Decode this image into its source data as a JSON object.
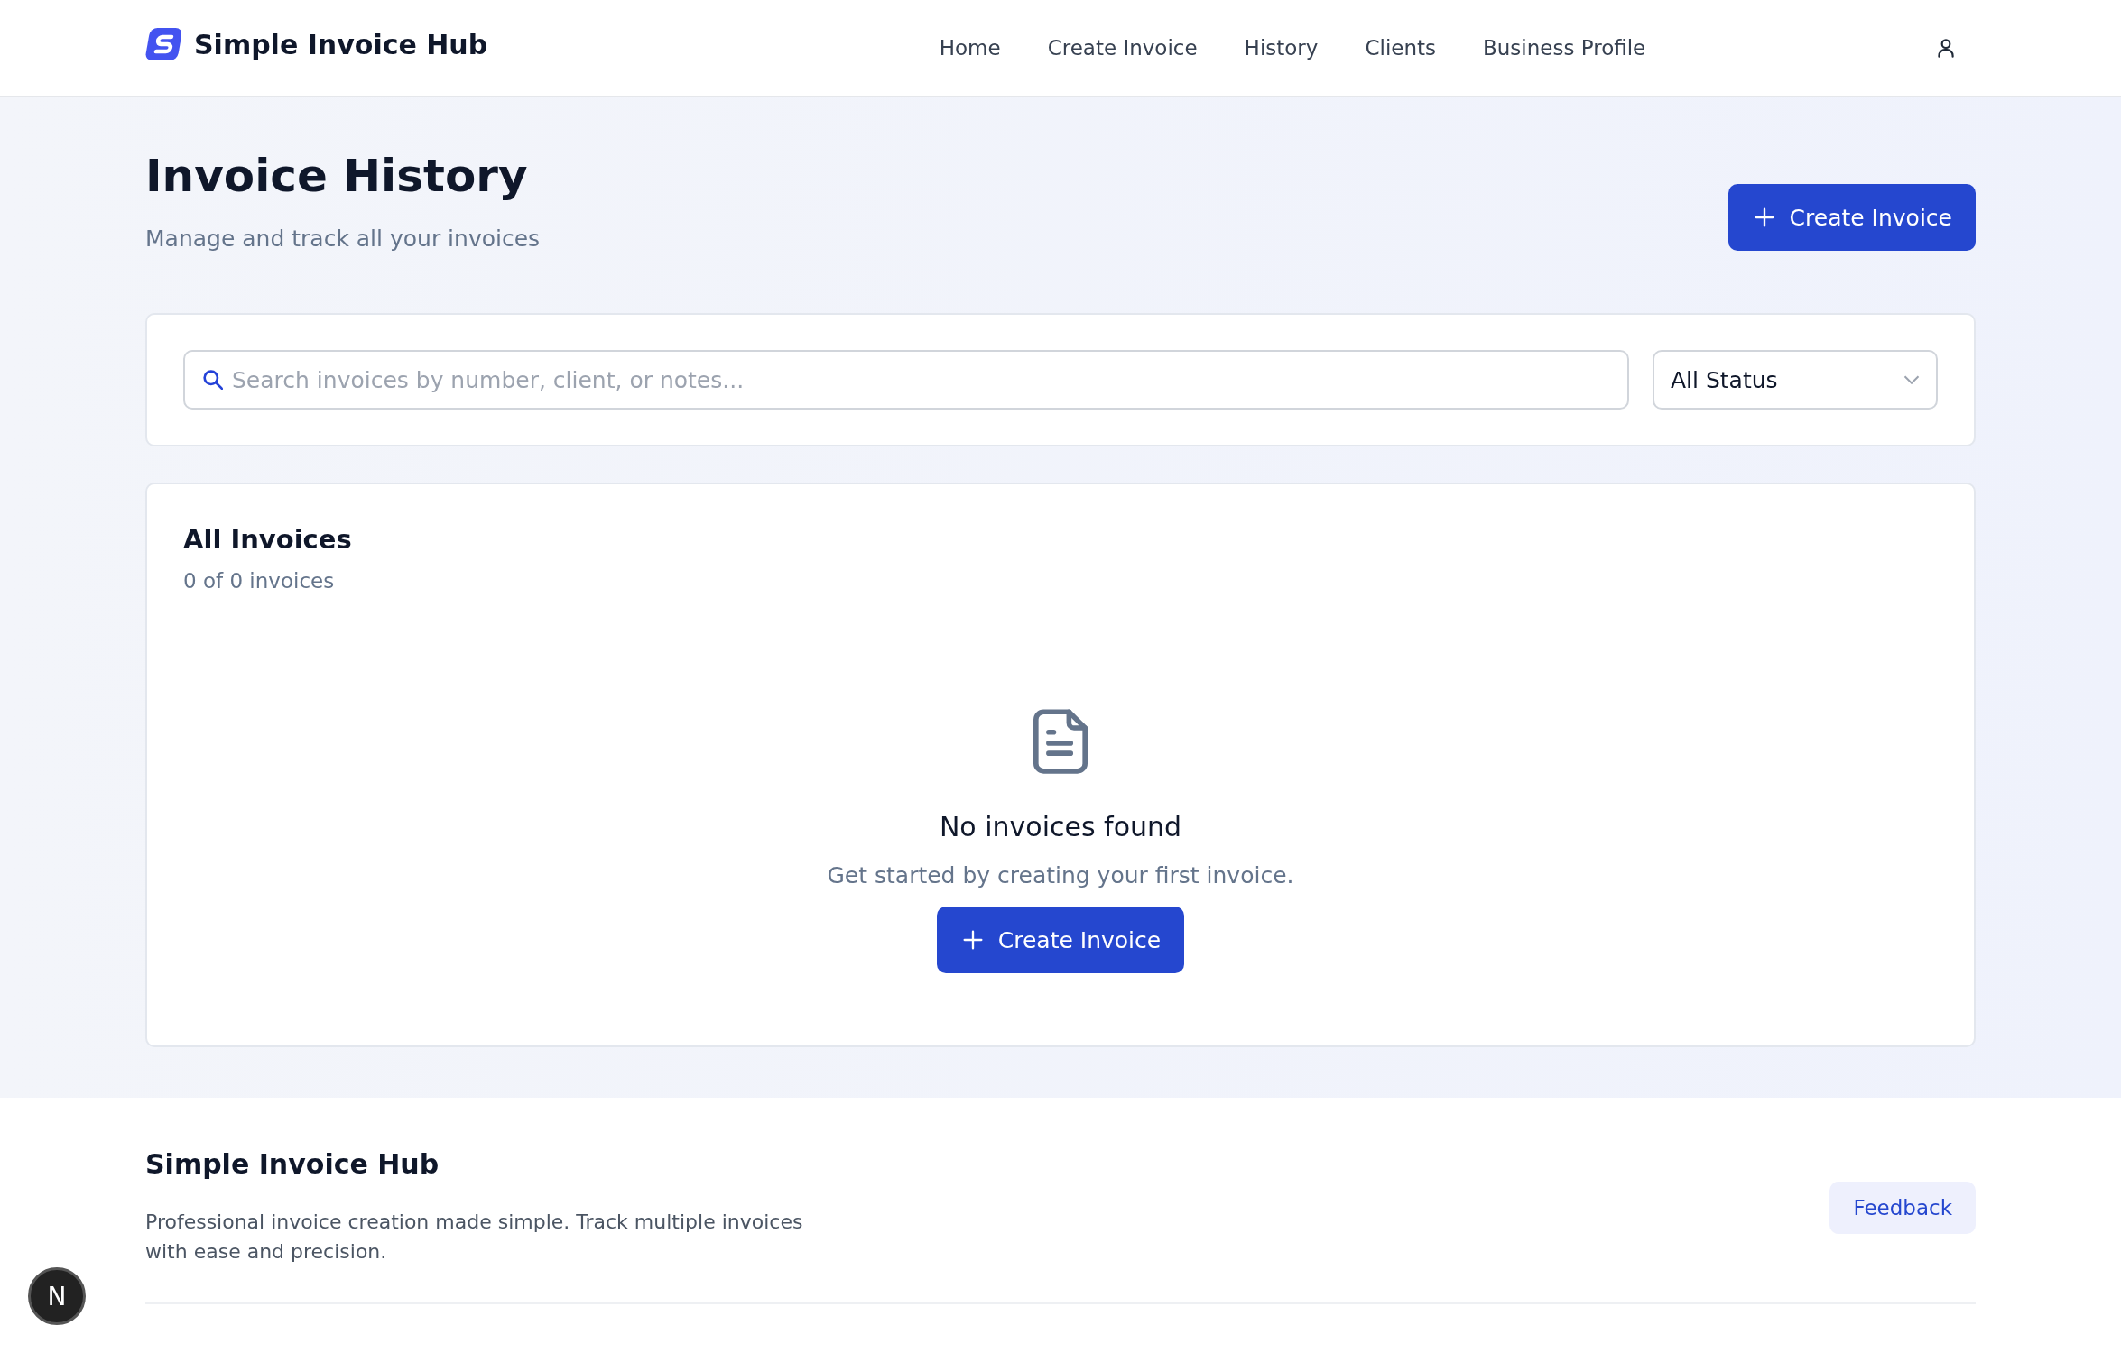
{
  "header": {
    "brand": "Simple Invoice Hub",
    "nav": [
      "Home",
      "Create Invoice",
      "History",
      "Clients",
      "Business Profile"
    ]
  },
  "page": {
    "title": "Invoice History",
    "subtitle": "Manage and track all your invoices",
    "create_button": "Create Invoice"
  },
  "filters": {
    "search": {
      "placeholder": "Search invoices by number, client, or notes..."
    },
    "status": {
      "value": "All Status"
    }
  },
  "invoices": {
    "title": "All Invoices",
    "count": "0 of 0 invoices",
    "empty": {
      "title": "No invoices found",
      "message": "Get started by creating your first invoice.",
      "button": "Create Invoice"
    }
  },
  "footer": {
    "brand": "Simple Invoice Hub",
    "description": "Professional invoice creation made simple. Track multiple invoices with ease and precision.",
    "feedback": "Feedback"
  },
  "dev_badge": "N"
}
